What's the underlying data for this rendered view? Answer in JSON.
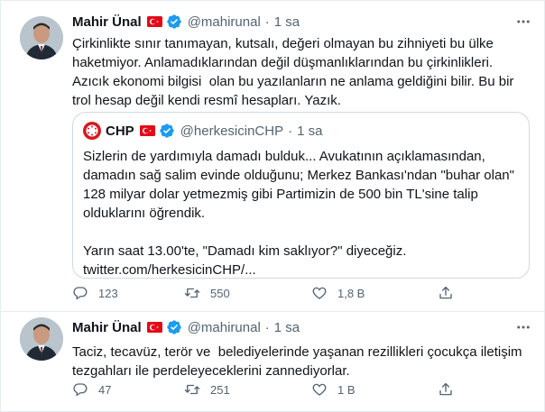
{
  "colors": {
    "text": "#0f1419",
    "muted": "#536471",
    "verified": "#1d9bf0",
    "turkey_red": "#e30a17",
    "chp_red": "#d7191f",
    "border": "#cfd9de"
  },
  "tweets": [
    {
      "author_name": "Mahir Ünal",
      "handle": "@mahirunal",
      "separator": "·",
      "time": "1 sa",
      "text": "Çirkinlikte sınır tanımayan, kutsalı, değeri olmayan bu zihniyeti bu ülke haketmiyor. Anlamadıklarından değil düşmanlıklarından bu çirkinlikleri. Azıcık ekonomi bilgisi  olan bu yazılanların ne anlama geldiğini bilir. Bu bir trol hesap değil kendi resmî hesapları. Yazık.",
      "quote": {
        "author_name": "CHP",
        "handle": "@herkesicinCHP",
        "separator": "·",
        "time": "1 sa",
        "text": "Sizlerin de yardımıyla damadı bulduk... Avukatının açıklamasından, damadın sağ salim evinde olduğunu; Merkez Bankası'ndan \"buhar olan\" 128 milyar dolar yetmezmiş gibi Partimizin de 500 bin TL'sine talip olduklarını öğrendik.\n\nYarın saat 13.00'te, \"Damadı kim saklıyor?\" diyeceğiz.\ntwitter.com/herkesicinCHP/..."
      },
      "actions": {
        "replies": "123",
        "retweets": "550",
        "likes": "1,8 B"
      }
    },
    {
      "author_name": "Mahir Ünal",
      "handle": "@mahirunal",
      "separator": "·",
      "time": "1 sa",
      "text": "Taciz, tecavüz, terör ve  belediyelerinde yaşanan rezillikleri çocukça iletişim tezgahları ile perdeleyeceklerini zannediyorlar.",
      "actions": {
        "replies": "47",
        "retweets": "251",
        "likes": "1 B"
      }
    }
  ],
  "icons": {
    "more": "more-dots-icon",
    "verified": "verified-badge-icon",
    "flag": "turkey-flag-icon",
    "reply": "reply-icon",
    "retweet": "retweet-icon",
    "like": "heart-icon",
    "share": "share-icon"
  }
}
